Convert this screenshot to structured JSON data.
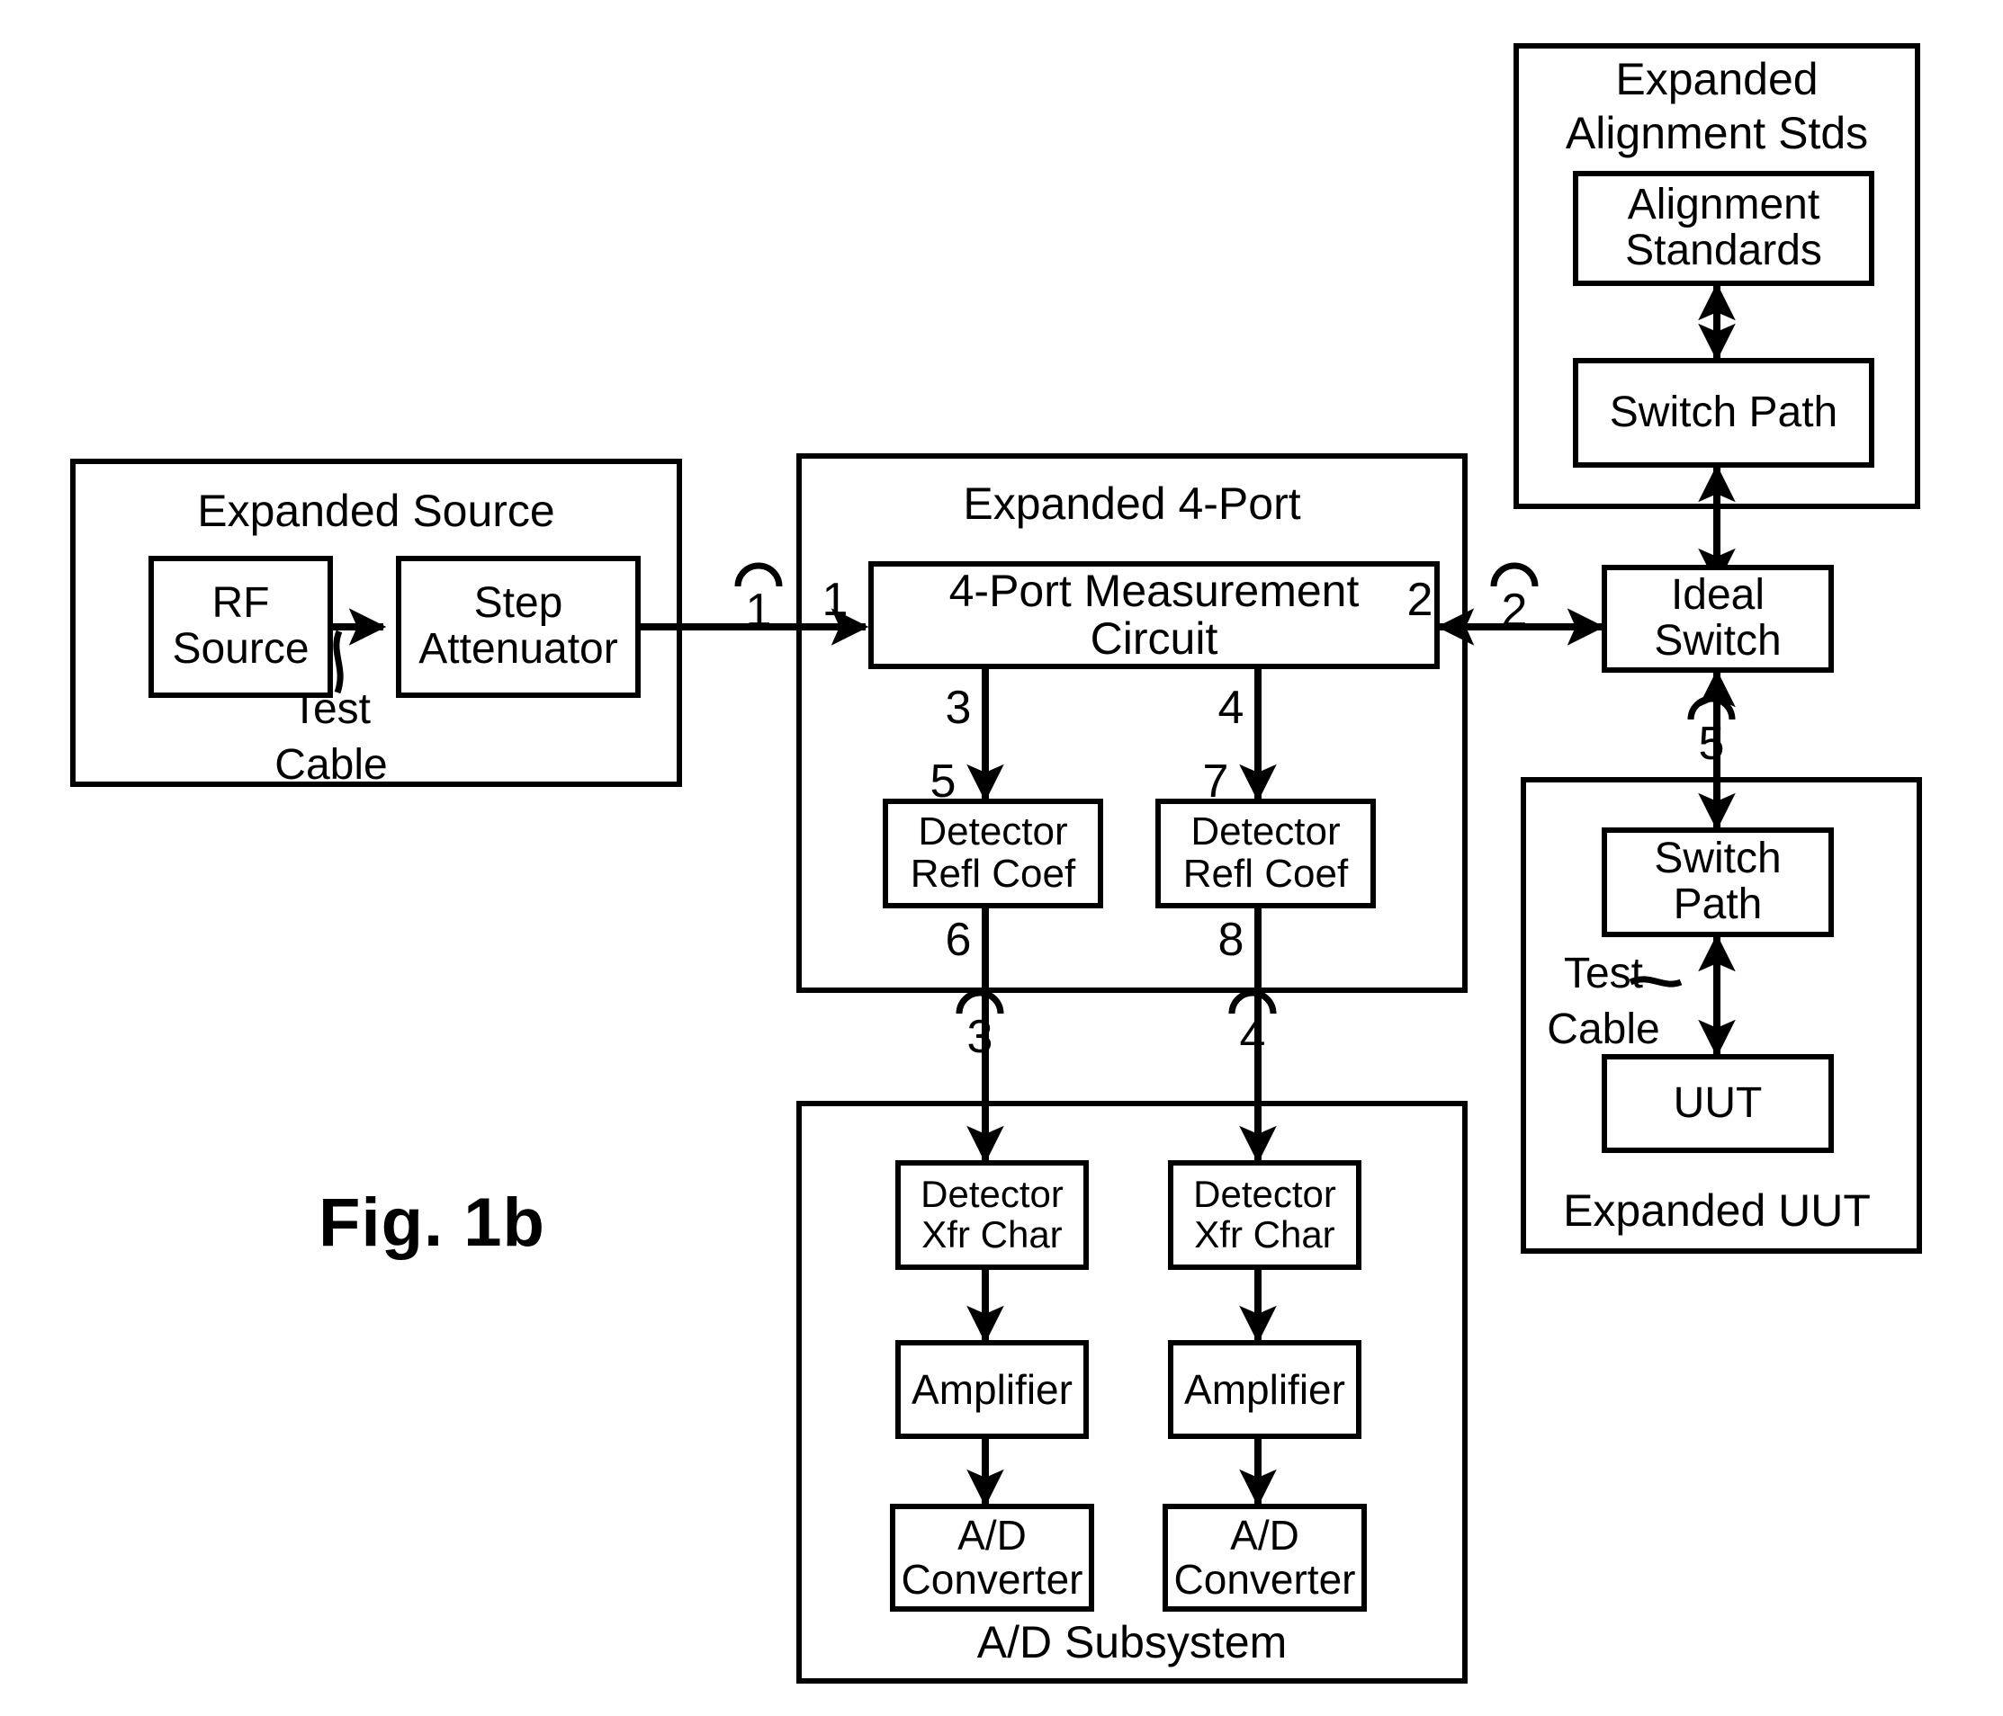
{
  "figure": {
    "label": "Fig. 1b"
  },
  "groups": {
    "expanded_source": {
      "title": "Expanded Source"
    },
    "expanded_4port": {
      "title": "Expanded 4-Port"
    },
    "expanded_alignment_stds": {
      "title_line1": "Expanded",
      "title_line2": "Alignment Stds"
    },
    "expanded_uut": {
      "title": "Expanded UUT"
    },
    "ad_subsystem": {
      "title": "A/D Subsystem"
    }
  },
  "blocks": {
    "rf_source": {
      "line1": "RF",
      "line2": "Source"
    },
    "step_attenuator": {
      "line1": "Step",
      "line2": "Attenuator"
    },
    "four_port_measurement_circuit": {
      "line1": "4-Port Measurement",
      "line2": "Circuit"
    },
    "detector_refl_coef_left": {
      "line1": "Detector",
      "line2": "Refl Coef"
    },
    "detector_refl_coef_right": {
      "line1": "Detector",
      "line2": "Refl Coef"
    },
    "detector_xfr_char_left": {
      "line1": "Detector",
      "line2": "Xfr Char"
    },
    "detector_xfr_char_right": {
      "line1": "Detector",
      "line2": "Xfr Char"
    },
    "amplifier_left": {
      "line1": "Amplifier"
    },
    "amplifier_right": {
      "line1": "Amplifier"
    },
    "ad_converter_left": {
      "line1": "A/D",
      "line2": "Converter"
    },
    "ad_converter_right": {
      "line1": "A/D",
      "line2": "Converter"
    },
    "alignment_standards": {
      "line1": "Alignment",
      "line2": "Standards"
    },
    "switch_path_top": {
      "line1": "Switch Path"
    },
    "ideal_switch": {
      "line1": "Ideal",
      "line2": "Switch"
    },
    "switch_path_uut": {
      "line1": "Switch",
      "line2": "Path"
    },
    "uut": {
      "line1": "UUT"
    }
  },
  "annotations": {
    "test_cable_source": {
      "line1": "Test",
      "line2": "Cable"
    },
    "test_cable_uut": {
      "line1": "Test",
      "line2": "Cable"
    }
  },
  "port_labels": {
    "source_out_arc": "1",
    "fourport_in": "1",
    "fourport_out_right": "2",
    "switch_in_arc": "2",
    "fourport_port3": "3",
    "fourport_port4": "4",
    "detector_left_in": "5",
    "detector_right_in": "7",
    "detector_left_out": "6",
    "detector_right_out": "8",
    "ad_left_arc": "3",
    "ad_right_arc": "4",
    "uut_switch_arc": "5"
  },
  "colors": {
    "stroke": "#000000",
    "background": "#ffffff"
  }
}
